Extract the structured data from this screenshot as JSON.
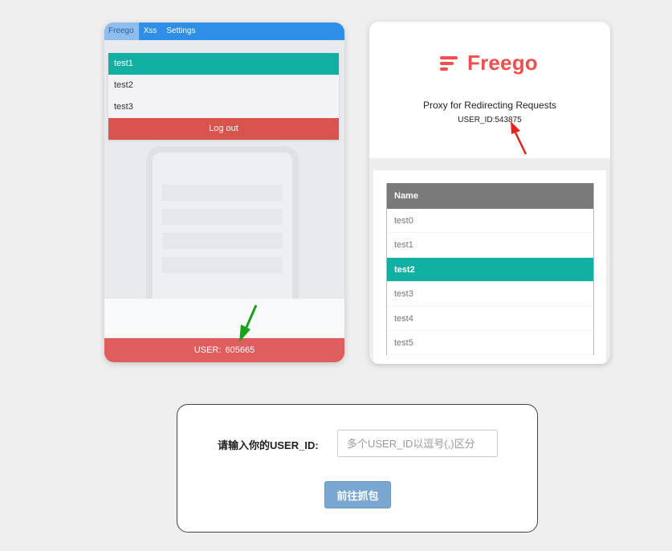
{
  "left_card": {
    "tabs": [
      "Freego",
      "Xss",
      "Settings"
    ],
    "active_tab": "Freego",
    "dropdown_items": [
      "test1",
      "test2",
      "test3"
    ],
    "selected_item": "test1",
    "logout_label": "Log out",
    "user_prefix": "USER:",
    "user_value": "605665"
  },
  "right_card": {
    "brand_name": "Freego",
    "tagline": "Proxy for Redirecting Requests",
    "user_id_label": "USER_ID:",
    "user_id_value": "543875",
    "table": {
      "header": "Name",
      "rows": [
        "test0",
        "test1",
        "test2",
        "test3",
        "test4",
        "test5"
      ],
      "selected_row": "test2"
    }
  },
  "form": {
    "label": "请输入你的USER_ID:",
    "input_value": "",
    "input_placeholder": "多个USER_ID以逗号(,)区分",
    "button_label": "前往抓包"
  },
  "colors": {
    "tab_bar": "#2f8fe8",
    "teal_select": "#12b0a3",
    "logout_red": "#d9534f",
    "user_bar_red": "#df5d5d",
    "brand_red": "#f24e4e",
    "button_blue": "#7aa7d1",
    "annotation_red": "#e8211c",
    "annotation_green": "#1aa11a"
  },
  "icons": [
    "freego-logo-icon",
    "red-annotation-arrow",
    "green-annotation-arrow"
  ]
}
